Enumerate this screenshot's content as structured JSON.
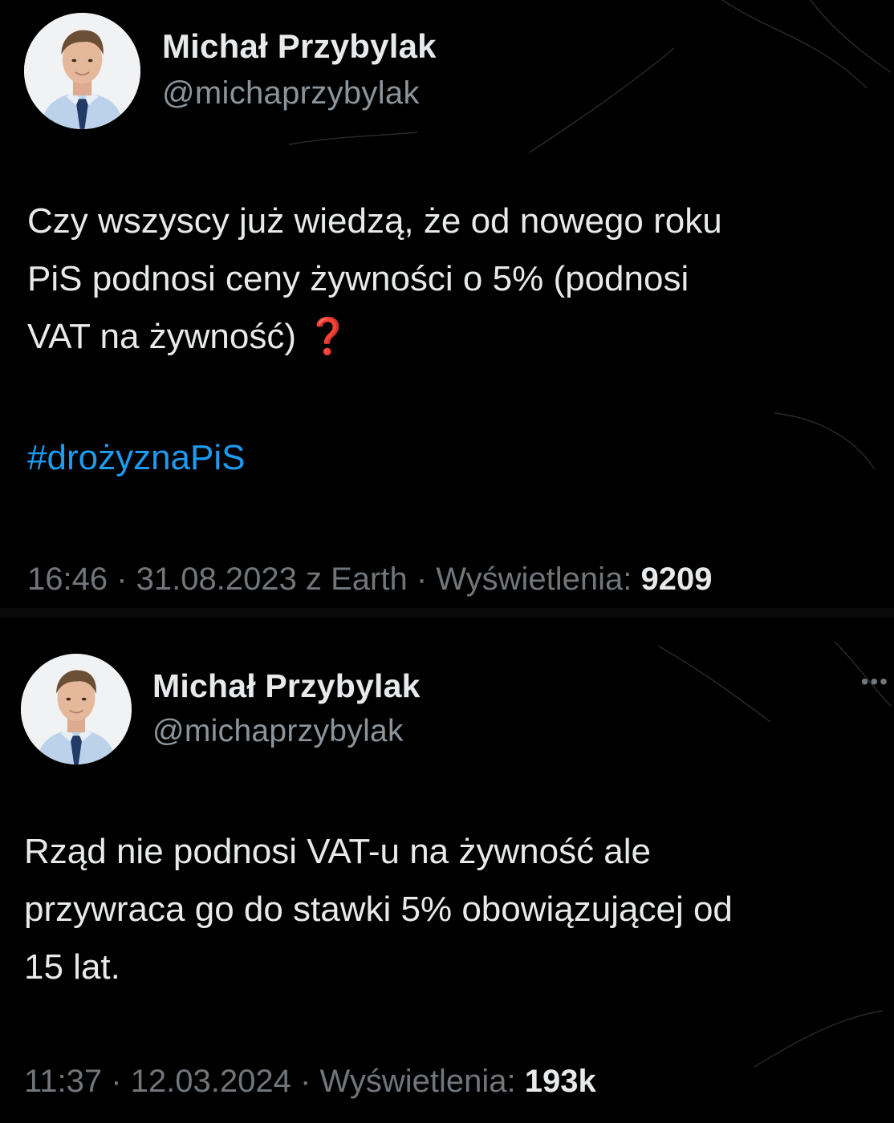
{
  "colors": {
    "background": "#000000",
    "text": "#e7e9ea",
    "secondary_text": "#71767b",
    "hashtag": "#1d9bf0",
    "question_mark": "#e0262b"
  },
  "tweets": [
    {
      "author_name": "Michał Przybylak",
      "author_handle": "@michaprzybylak",
      "avatar_icon": "profile-photo-man-in-suit",
      "text": "Czy wszyscy już wiedzą, że od nowego roku\nPiS podnosi ceny żywności o 5% (podnosi\nVAT na żywność) ",
      "emoji": "❓",
      "hashtag": "#drożyznaPiS",
      "time": "16:46",
      "separator_1": " · ",
      "date": "31.08.2023",
      "source": " z Earth",
      "separator_2": " · ",
      "views_label": "Wyświetlenia: ",
      "views_count": "9209"
    },
    {
      "author_name": "Michał Przybylak",
      "author_handle": "@michaprzybylak",
      "avatar_icon": "profile-photo-man-in-suit",
      "more_icon": "more-horizontal-icon",
      "more_glyph": "•••",
      "text": "Rząd nie podnosi VAT-u na żywność ale\nprzywraca go do stawki 5% obowiązującej od\n15 lat.",
      "time": "11:37",
      "separator_1": " · ",
      "date": "12.03.2024",
      "separator_2": " · ",
      "views_label": "Wyświetlenia: ",
      "views_count": "193k"
    }
  ]
}
